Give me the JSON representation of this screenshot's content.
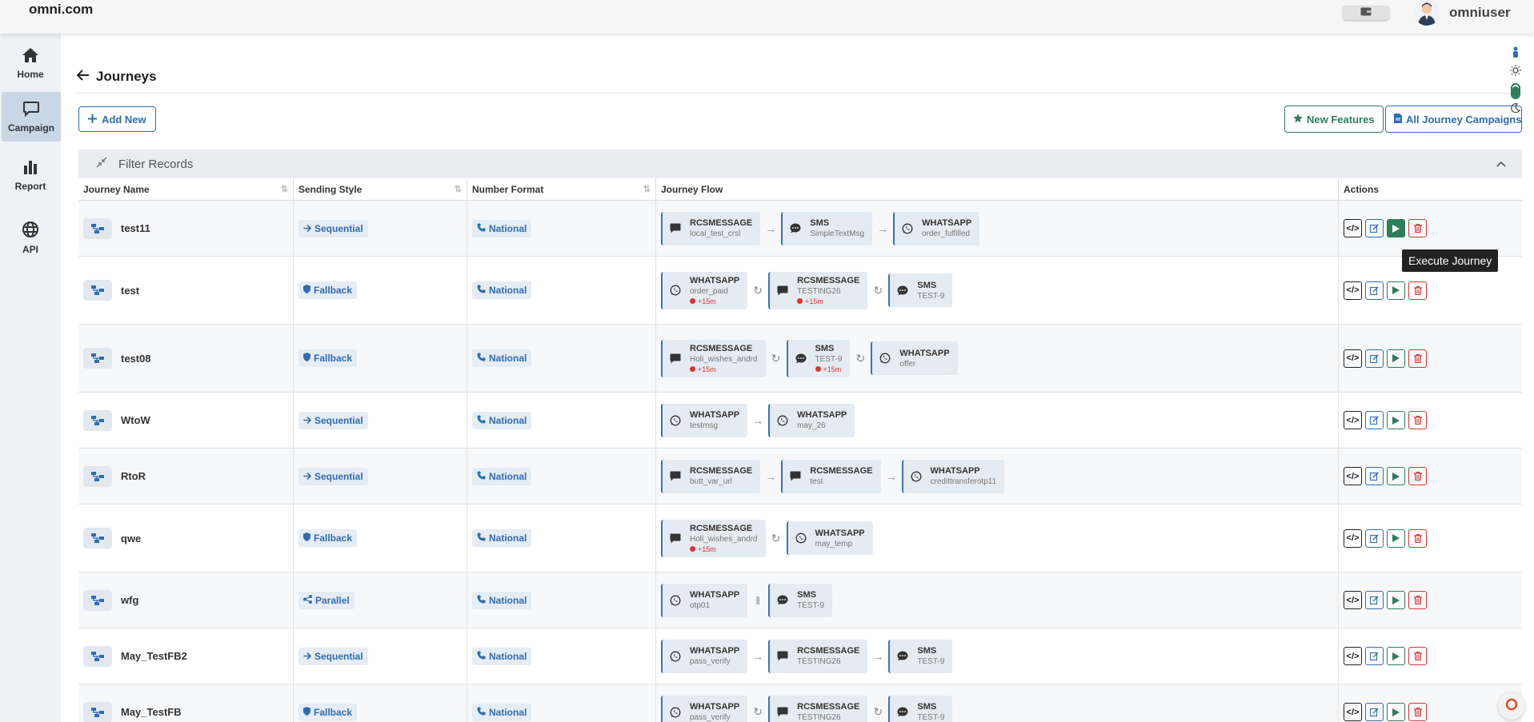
{
  "header": {
    "brand": "omni.com",
    "username": "omniuser"
  },
  "sidebar": {
    "items": [
      {
        "label": "Home",
        "icon": "home-icon"
      },
      {
        "label": "Campaign",
        "icon": "chat-icon",
        "active": true
      },
      {
        "label": "Report",
        "icon": "bar-chart-icon"
      },
      {
        "label": "API",
        "icon": "globe-icon"
      }
    ]
  },
  "page": {
    "title": "Journeys"
  },
  "toolbar": {
    "add_new": "Add New",
    "new_features": "New Features",
    "all_campaigns": "All Journey Campaigns"
  },
  "filter": {
    "label": "Filter Records"
  },
  "table": {
    "headers": {
      "name": "Journey Name",
      "style": "Sending Style",
      "format": "Number Format",
      "flow": "Journey Flow",
      "actions": "Actions"
    },
    "rows": [
      {
        "name": "test11",
        "style": "Sequential",
        "style_icon": "arrow-right-icon",
        "format": "National",
        "connector": "→",
        "flow": [
          {
            "channel": "RCSMESSAGE",
            "template": "local_test_crsl",
            "icon": "message-icon"
          },
          {
            "channel": "SMS",
            "template": "SimpleTextMsg",
            "icon": "sms-icon"
          },
          {
            "channel": "WHATSAPP",
            "template": "order_fulfilled",
            "icon": "whatsapp-icon"
          }
        ]
      },
      {
        "name": "test",
        "style": "Fallback",
        "style_icon": "shield-icon",
        "format": "National",
        "connector": "↻",
        "flow": [
          {
            "channel": "WHATSAPP",
            "template": "order_paid",
            "delay": "+15m",
            "icon": "whatsapp-icon"
          },
          {
            "channel": "RCSMESSAGE",
            "template": "TESTING26",
            "delay": "+15m",
            "icon": "message-icon"
          },
          {
            "channel": "SMS",
            "template": "TEST-9",
            "icon": "sms-icon"
          }
        ]
      },
      {
        "name": "test08",
        "style": "Fallback",
        "style_icon": "shield-icon",
        "format": "National",
        "connector": "↻",
        "flow": [
          {
            "channel": "RCSMESSAGE",
            "template": "Holi_wishes_andrd",
            "delay": "+15m",
            "icon": "message-icon"
          },
          {
            "channel": "SMS",
            "template": "TEST-9",
            "delay": "+15m",
            "icon": "sms-icon"
          },
          {
            "channel": "WHATSAPP",
            "template": "offer",
            "icon": "whatsapp-icon"
          }
        ]
      },
      {
        "name": "WtoW",
        "style": "Sequential",
        "style_icon": "arrow-right-icon",
        "format": "National",
        "connector": "→",
        "flow": [
          {
            "channel": "WHATSAPP",
            "template": "testmsg",
            "icon": "whatsapp-icon"
          },
          {
            "channel": "WHATSAPP",
            "template": "may_26",
            "icon": "whatsapp-icon"
          }
        ]
      },
      {
        "name": "RtoR",
        "style": "Sequential",
        "style_icon": "arrow-right-icon",
        "format": "National",
        "connector": "→",
        "flow": [
          {
            "channel": "RCSMESSAGE",
            "template": "butt_var_url",
            "icon": "message-icon"
          },
          {
            "channel": "RCSMESSAGE",
            "template": "test",
            "icon": "message-icon"
          },
          {
            "channel": "WHATSAPP",
            "template": "credittransferotp11",
            "icon": "whatsapp-icon"
          }
        ]
      },
      {
        "name": "qwe",
        "style": "Fallback",
        "style_icon": "shield-icon",
        "format": "National",
        "connector": "↻",
        "flow": [
          {
            "channel": "RCSMESSAGE",
            "template": "Holi_wishes_andrd",
            "delay": "+15m",
            "icon": "message-icon"
          },
          {
            "channel": "WHATSAPP",
            "template": "may_temp",
            "icon": "whatsapp-icon"
          }
        ]
      },
      {
        "name": "wfg",
        "style": "Parallel",
        "style_icon": "share-icon",
        "format": "National",
        "connector": "‖",
        "flow": [
          {
            "channel": "WHATSAPP",
            "template": "otp01",
            "icon": "whatsapp-icon"
          },
          {
            "channel": "SMS",
            "template": "TEST-9",
            "icon": "sms-icon"
          }
        ]
      },
      {
        "name": "May_TestFB2",
        "style": "Sequential",
        "style_icon": "arrow-right-icon",
        "format": "National",
        "connector": "→",
        "flow": [
          {
            "channel": "WHATSAPP",
            "template": "pass_verify",
            "icon": "whatsapp-icon"
          },
          {
            "channel": "RCSMESSAGE",
            "template": "TESTING26",
            "icon": "message-icon"
          },
          {
            "channel": "SMS",
            "template": "TEST-9",
            "icon": "sms-icon"
          }
        ]
      },
      {
        "name": "May_TestFB",
        "style": "Fallback",
        "style_icon": "shield-icon",
        "format": "National",
        "connector": "↻",
        "flow": [
          {
            "channel": "WHATSAPP",
            "template": "pass_verify",
            "icon": "whatsapp-icon"
          },
          {
            "channel": "RCSMESSAGE",
            "template": "TESTING26",
            "icon": "message-icon"
          },
          {
            "channel": "SMS",
            "template": "TEST-9",
            "icon": "sms-icon"
          }
        ]
      }
    ]
  },
  "tooltip": {
    "text": "Execute Journey"
  },
  "colors": {
    "primary": "#2f6db3",
    "success": "#2e7d5b",
    "danger": "#dd3333",
    "sidebar": "#eef1f5"
  }
}
